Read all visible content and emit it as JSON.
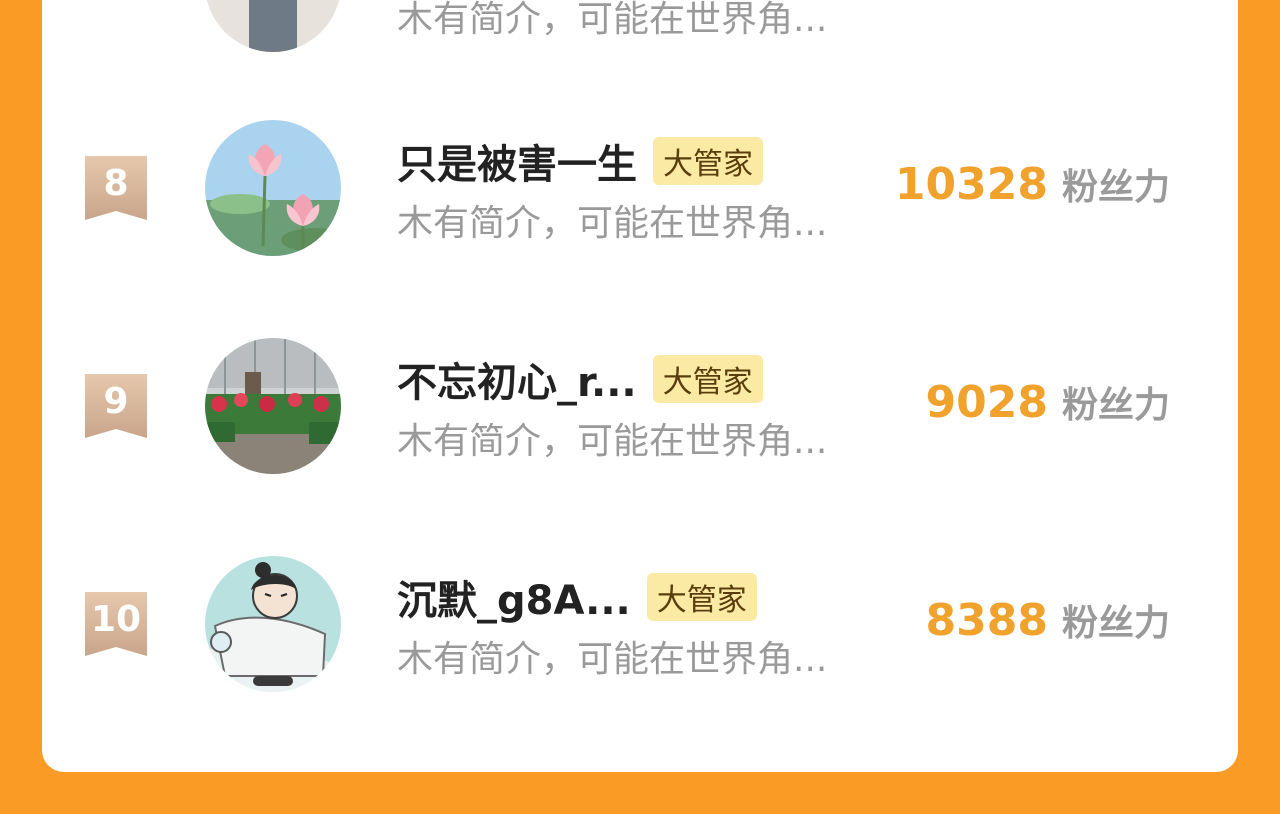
{
  "top_partial": {
    "desc": "木有简介，可能在世界角..."
  },
  "rows": [
    {
      "rank": "8",
      "name": "只是被害一生",
      "badge": "大管家",
      "desc": "木有简介，可能在世界角...",
      "fans_value": "10328",
      "fans_label": "粉丝力"
    },
    {
      "rank": "9",
      "name": "不忘初心_r...",
      "badge": "大管家",
      "desc": "木有简介，可能在世界角...",
      "fans_value": "9028",
      "fans_label": "粉丝力"
    },
    {
      "rank": "10",
      "name": "沉默_g8A...",
      "badge": "大管家",
      "desc": "木有简介，可能在世界角...",
      "fans_value": "8388",
      "fans_label": "粉丝力"
    }
  ],
  "colors": {
    "page_background": "#f99b25",
    "fans_number": "#f0a22d",
    "badge_background": "#fbeaa3",
    "rank_ribbon": "#d8b89c"
  }
}
